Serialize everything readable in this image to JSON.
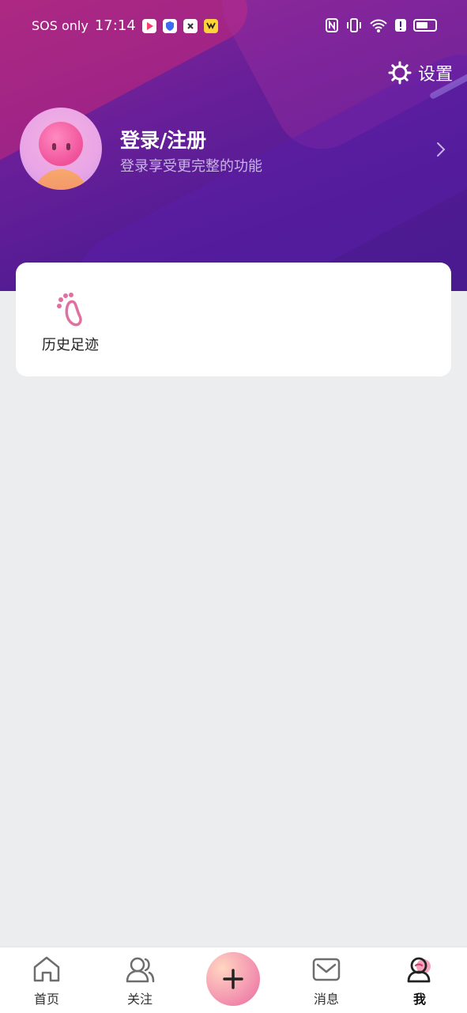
{
  "status": {
    "carrier": "SOS only",
    "time": "17:14",
    "battery_level": 0.65
  },
  "header": {
    "settings_label": "设置"
  },
  "profile": {
    "title": "登录/注册",
    "subtitle": "登录享受更完整的功能"
  },
  "quick": {
    "history_label": "历史足迹"
  },
  "tabs": [
    {
      "label": "首页",
      "icon": "home-icon"
    },
    {
      "label": "关注",
      "icon": "follow-icon"
    },
    {
      "label": "",
      "icon": "plus-icon"
    },
    {
      "label": "消息",
      "icon": "message-icon"
    },
    {
      "label": "我",
      "icon": "me-icon",
      "active": true
    }
  ],
  "colors": {
    "hero": "#4f1b93",
    "accent": "#e86aa0",
    "background": "#ecedef"
  }
}
